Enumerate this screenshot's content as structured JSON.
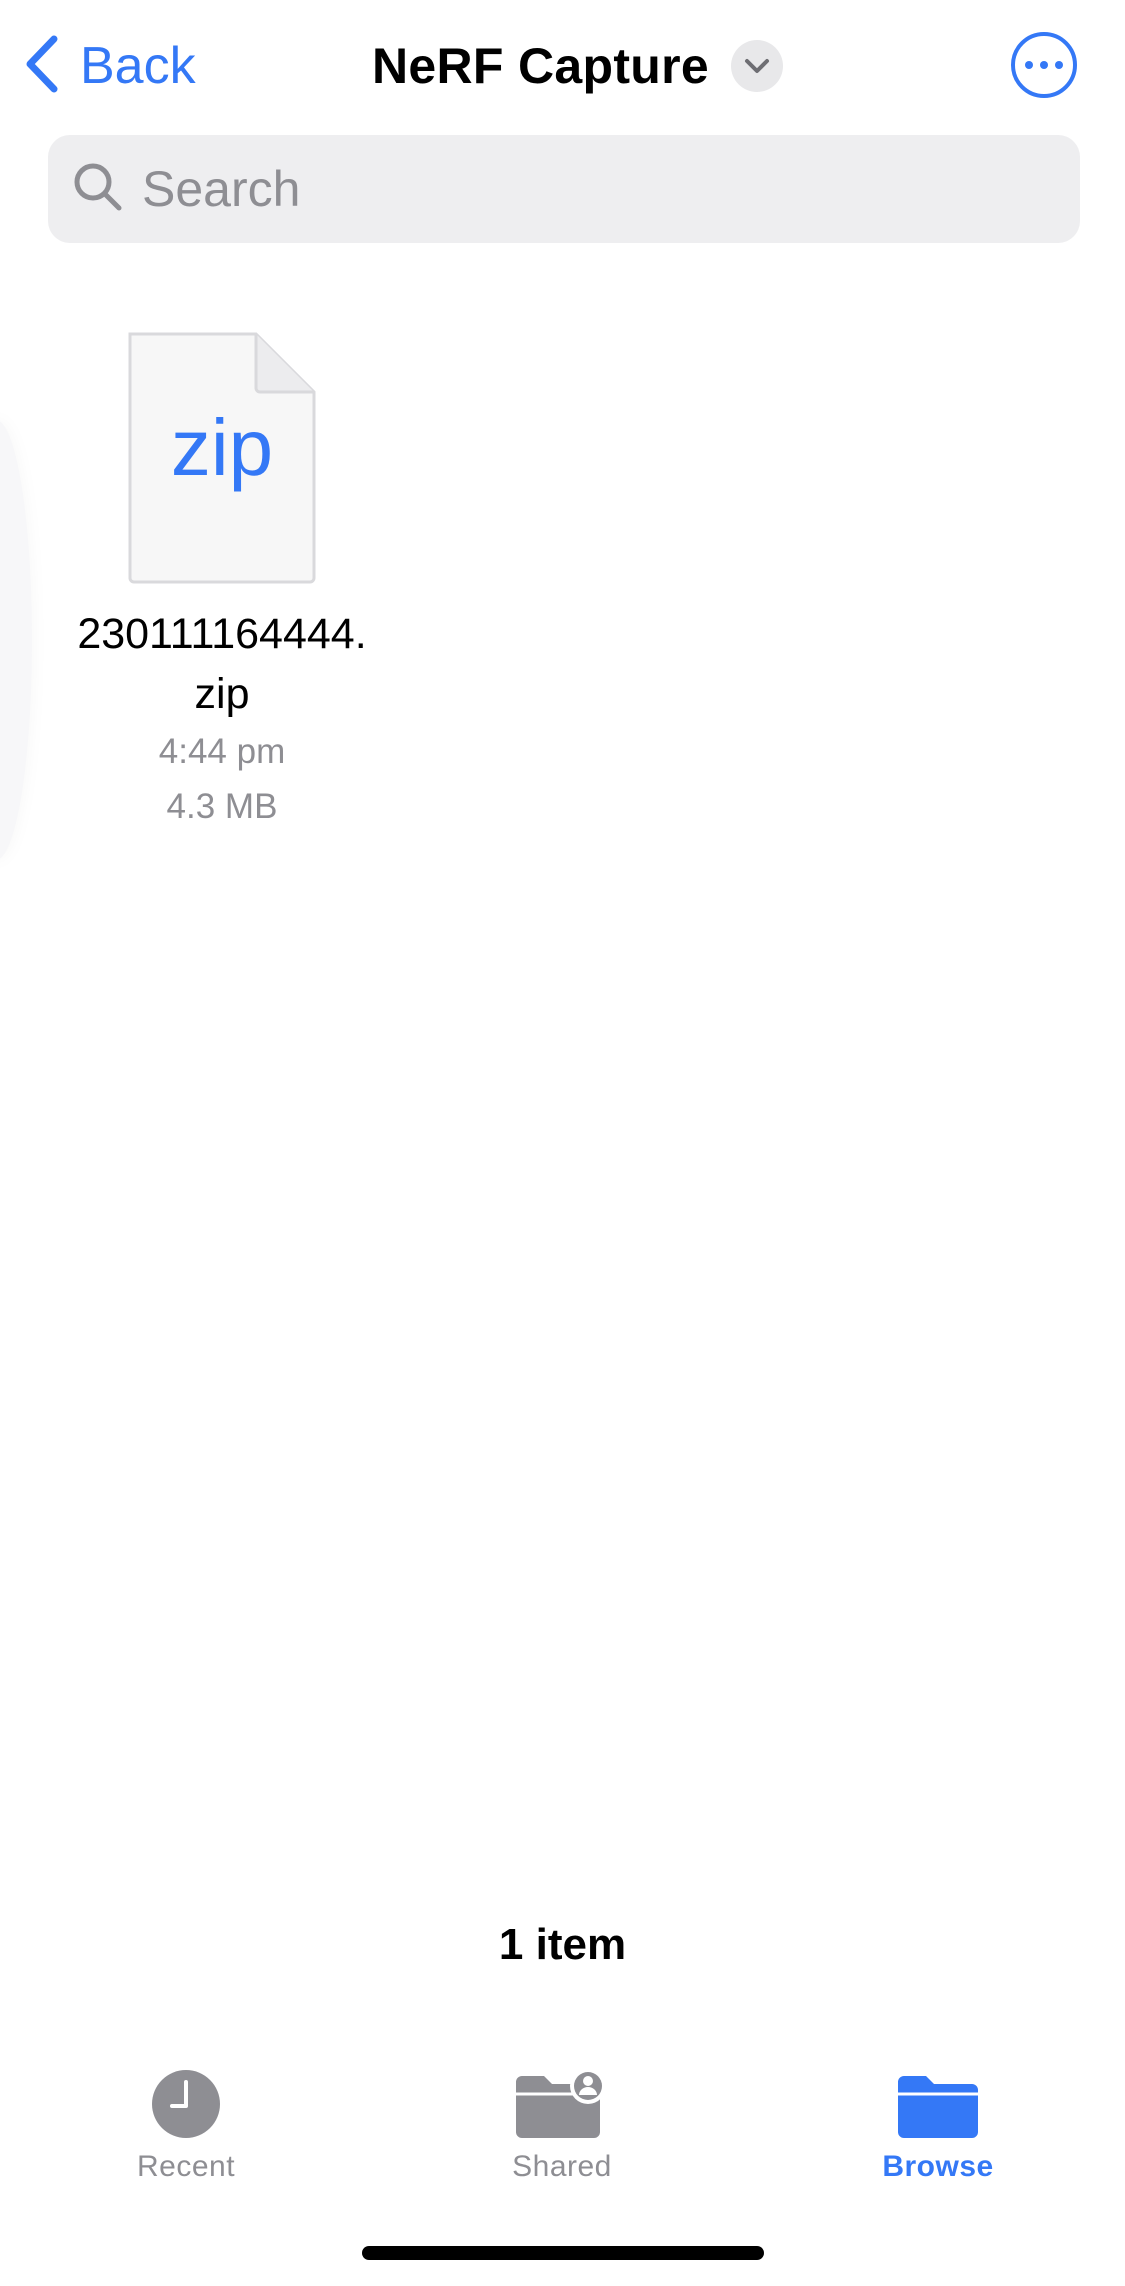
{
  "nav": {
    "back_label": "Back",
    "title": "NeRF Capture"
  },
  "search": {
    "placeholder": "Search"
  },
  "files": [
    {
      "extension": "zip",
      "name": "230111164444.zip",
      "time": "4:44 pm",
      "size": "4.3 MB"
    }
  ],
  "footer": {
    "item_count": "1 item"
  },
  "tabbar": {
    "recent_label": "Recent",
    "shared_label": "Shared",
    "browse_label": "Browse",
    "active": "Browse"
  },
  "colors": {
    "accent": "#3478f6",
    "secondary_text": "#8e8e93",
    "search_bg": "#eeeef0"
  },
  "icons": {
    "back": "chevron-left-icon",
    "title_menu": "chevron-down-icon",
    "more": "ellipsis-circle-icon",
    "search": "magnifying-glass-icon",
    "file": "zip-document-icon",
    "recent": "clock-icon",
    "shared": "shared-folder-icon",
    "browse": "folder-icon"
  }
}
